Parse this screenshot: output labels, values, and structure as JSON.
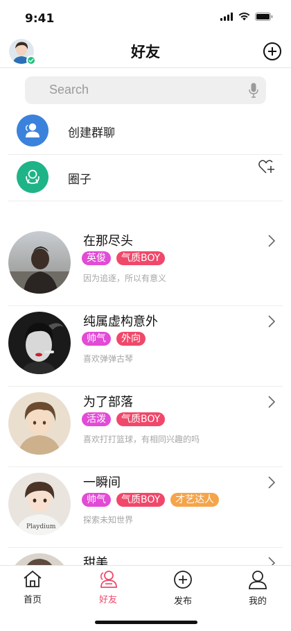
{
  "status_bar": {
    "time": "9:41"
  },
  "header": {
    "title": "好友"
  },
  "search": {
    "placeholder": "Search"
  },
  "quick_actions": [
    {
      "label": "创建群聊",
      "icon": "group-chat-icon",
      "color": "#3b82dc"
    },
    {
      "label": "圈子",
      "icon": "circle-community-icon",
      "color": "#1fb487"
    }
  ],
  "friends": [
    {
      "name": "在那尽头",
      "tags": [
        {
          "label": "英俊",
          "color": "#e24bd6"
        },
        {
          "label": "气质BOY",
          "color": "#f0486a"
        }
      ],
      "signature": "因为追逐，所以有意义"
    },
    {
      "name": "纯属虚构意外",
      "tags": [
        {
          "label": "帅气",
          "color": "#e24bd6"
        },
        {
          "label": "外向",
          "color": "#f0486a"
        }
      ],
      "signature": "喜欢弹弹古琴"
    },
    {
      "name": "为了部落",
      "tags": [
        {
          "label": "活泼",
          "color": "#e24bd6"
        },
        {
          "label": "气质BOY",
          "color": "#f0486a"
        }
      ],
      "signature": "喜欢打打篮球，有相同兴趣的吗"
    },
    {
      "name": "一瞬间",
      "tags": [
        {
          "label": "帅气",
          "color": "#e24bd6"
        },
        {
          "label": "气质BOY",
          "color": "#f0486a"
        },
        {
          "label": "才艺达人",
          "color": "#f5a44a"
        }
      ],
      "signature": "探索未知世界"
    },
    {
      "name": "甜美",
      "tags": [],
      "signature": ""
    }
  ],
  "tab_bar": [
    {
      "label": "首页",
      "icon": "home-icon",
      "active": false
    },
    {
      "label": "好友",
      "icon": "friends-icon",
      "active": true
    },
    {
      "label": "发布",
      "icon": "publish-icon",
      "active": false
    },
    {
      "label": "我的",
      "icon": "profile-icon",
      "active": false
    }
  ],
  "colors": {
    "accent": "#f0486a",
    "tag_magenta": "#e24bd6",
    "tag_red": "#f0486a",
    "tag_orange": "#f5a44a"
  }
}
